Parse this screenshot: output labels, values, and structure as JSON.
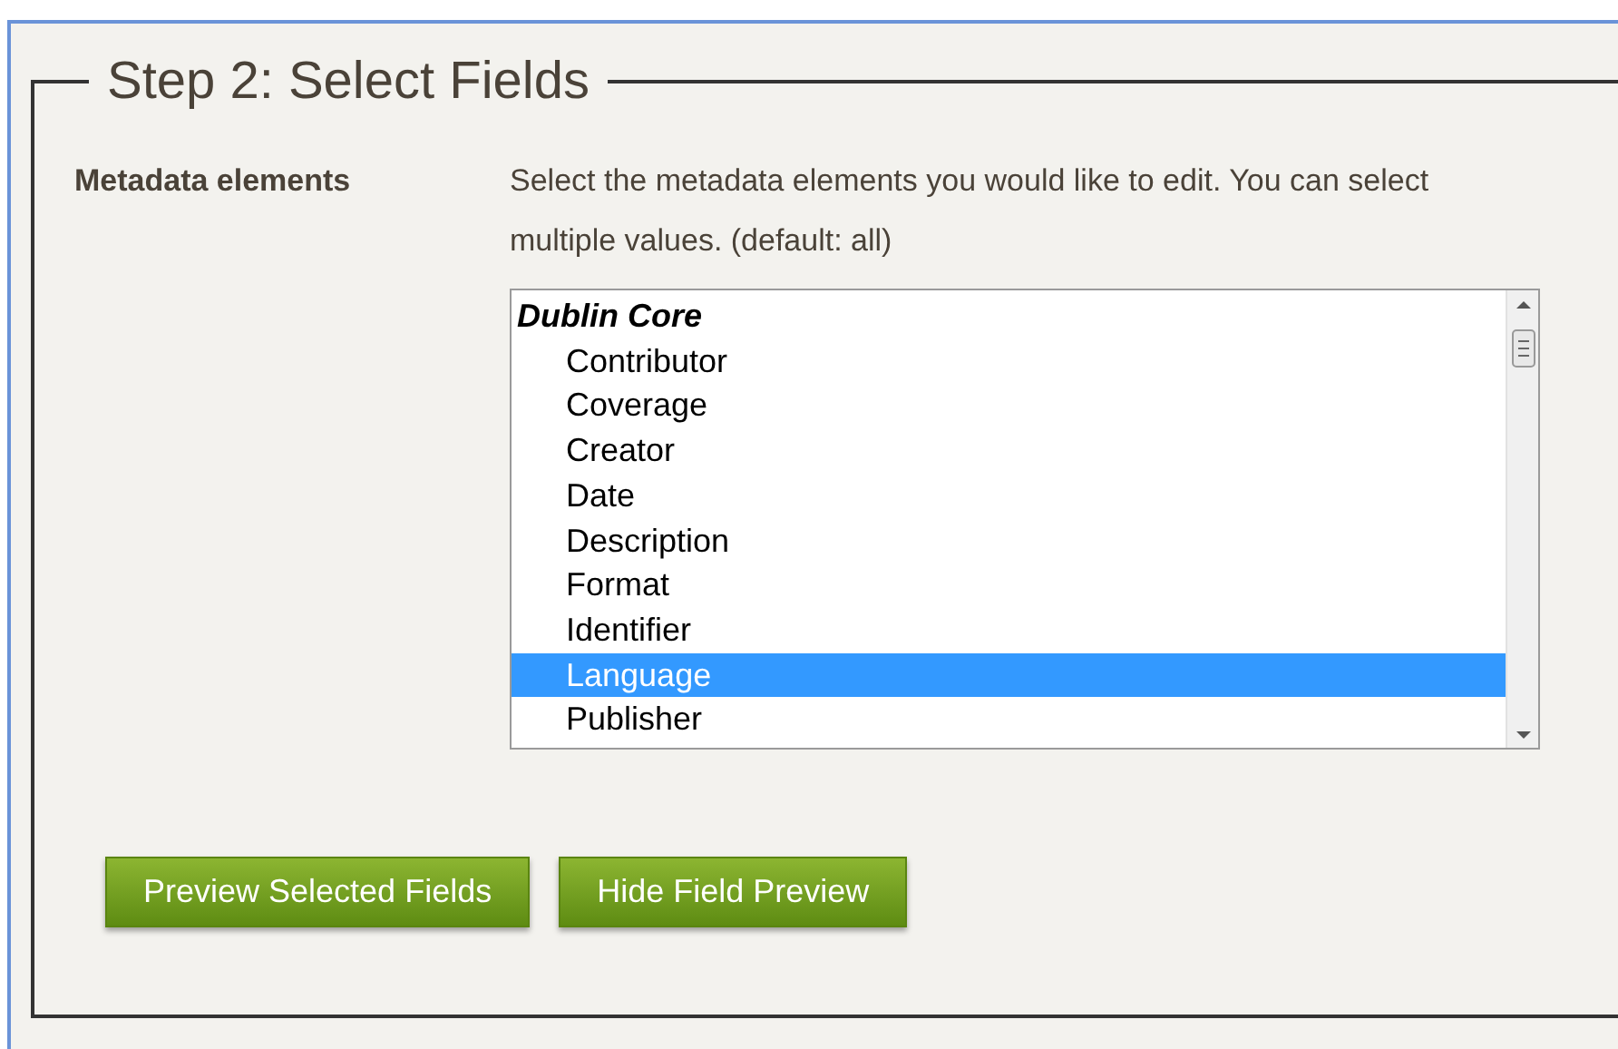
{
  "fieldset": {
    "legend": "Step 2: Select Fields"
  },
  "metadata": {
    "label": "Metadata elements",
    "help": "Select the metadata elements you would like to edit. You can select multiple values. (default: all)",
    "listbox": {
      "group": "Dublin Core",
      "options": [
        {
          "label": "Contributor",
          "selected": false
        },
        {
          "label": "Coverage",
          "selected": false
        },
        {
          "label": "Creator",
          "selected": false
        },
        {
          "label": "Date",
          "selected": false
        },
        {
          "label": "Description",
          "selected": false
        },
        {
          "label": "Format",
          "selected": false
        },
        {
          "label": "Identifier",
          "selected": false
        },
        {
          "label": "Language",
          "selected": true
        },
        {
          "label": "Publisher",
          "selected": false
        }
      ]
    }
  },
  "buttons": [
    "Preview Selected Fields",
    "Hide Field Preview"
  ]
}
